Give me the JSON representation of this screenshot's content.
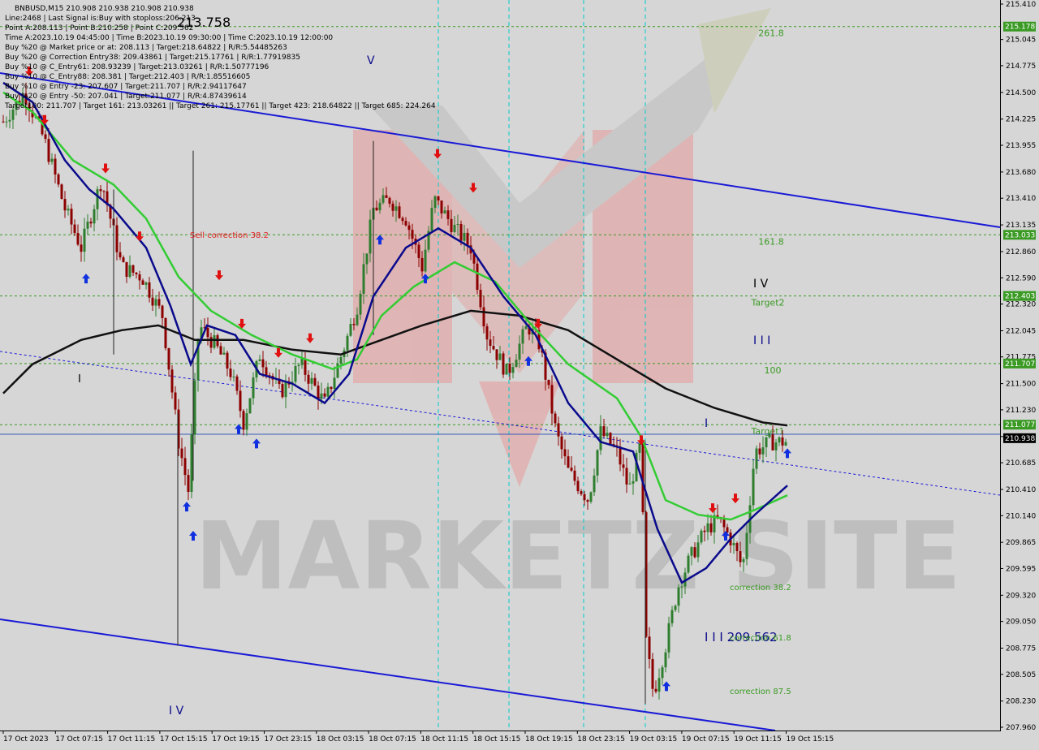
{
  "chart_data": {
    "type": "candlestick",
    "symbol_header": "BNBUSD,M15  210.908 210.938 210.908 210.938",
    "info_lines": [
      "Line:2468 | Last Signal is:Buy with stoploss:206.213",
      "Point A:208.113 | Point B:210.258 | Point C:209.562",
      "Time A:2023.10.19 04:45:00 | Time B:2023.10.19 09:30:00 | Time C:2023.10.19 12:00:00",
      "Buy %20 @ Market price or at: 208.113 | Target:218.64822 | R/R:5.54485263",
      "Buy %20 @ Correction Entry38: 209.43861 | Target:215.17761 | R/R:1.77919835",
      "Buy %10 @ C_Entry61: 208.93239 | Target:213.03261 | R/R:1.50777196",
      "Buy %10 @ C_Entry88: 208.381 | Target:212.403 | R/R:1.85516605",
      "Buy %10 @ Entry -23: 207.607 | Target:211.707 | R/R:2.94117647",
      "Buy %20 @ Entry -50: 207.041 | Target:211.077 | R/R:4.87439614",
      "Target100: 211.707 | Target 161: 213.03261 || Target 261: 215.17761 || Target 423: 218.64822 || Target 685: 224.264"
    ],
    "price_axis": {
      "min": 207.96,
      "max": 215.41,
      "ticks": [
        "215.410",
        "215.045",
        "214.775",
        "214.500",
        "214.225",
        "213.955",
        "213.680",
        "213.410",
        "213.135",
        "212.860",
        "212.590",
        "212.320",
        "212.045",
        "211.775",
        "211.500",
        "211.230",
        "210.955",
        "210.685",
        "210.410",
        "210.140",
        "209.865",
        "209.595",
        "209.320",
        "209.050",
        "208.775",
        "208.505",
        "208.230",
        "207.960"
      ]
    },
    "time_axis": {
      "labels": [
        "17 Oct 2023",
        "17 Oct 07:15",
        "17 Oct 11:15",
        "17 Oct 15:15",
        "17 Oct 19:15",
        "17 Oct 23:15",
        "18 Oct 03:15",
        "18 Oct 07:15",
        "18 Oct 11:15",
        "18 Oct 15:15",
        "18 Oct 19:15",
        "18 Oct 23:15",
        "19 Oct 03:15",
        "19 Oct 07:15",
        "19 Oct 11:15",
        "19 Oct 15:15"
      ]
    },
    "levels": [
      {
        "price": 215.178,
        "label": "215.178",
        "text": "261.8",
        "color": "#3a9a24"
      },
      {
        "price": 213.033,
        "label": "213.033",
        "text": "161.8",
        "color": "#3a9a24"
      },
      {
        "price": 212.403,
        "label": "212.403",
        "text": "Target2",
        "color": "#3a9a24"
      },
      {
        "price": 211.707,
        "label": "211.707",
        "text": "100",
        "color": "#3a9a24"
      },
      {
        "price": 211.077,
        "label": "211.077",
        "text": "Target1",
        "color": "#3a9a24"
      }
    ],
    "current_price": {
      "price": 210.938,
      "label": "210.938"
    },
    "annotations": {
      "price_high": "213.758",
      "sell_correction": "Sell correction 38.2",
      "wave_iv_top": "I V",
      "wave_iii": "I I I",
      "wave_i": "I",
      "wave_v": "V",
      "wave_iv_bottom": "I V",
      "wave_i_left": "I",
      "point_c": "I I I 209.562",
      "correction_382": "correction 38.2",
      "correction_618": "correction 61.8",
      "correction_875": "correction 87.5"
    },
    "watermark": "MARKETZ SITE",
    "colors": {
      "bull": "#2f7d2f",
      "bear": "#8c0000",
      "ma_fast": "#0a0a8c",
      "ma_mid": "#33cc33",
      "ma_slow": "#111111",
      "channel": "#1a1ad6",
      "vline": "#00cccc"
    }
  }
}
